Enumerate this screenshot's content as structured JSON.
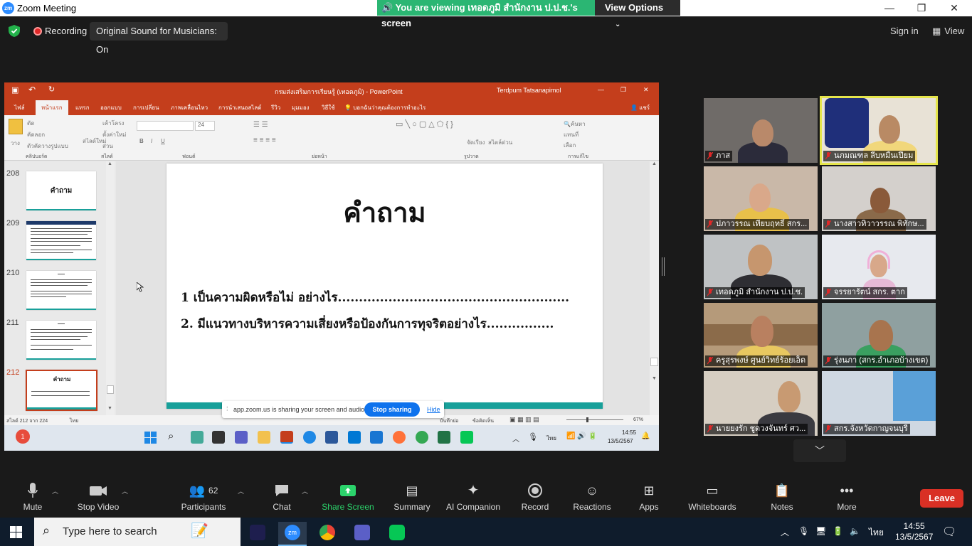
{
  "window": {
    "title": "Zoom Meeting",
    "logo": "zm",
    "minimize": "—",
    "restore": "❐",
    "close": "✕"
  },
  "banner": {
    "viewing": "You are viewing เทอดภูมิ สำนักงาน ป.ป.ช.'s screen",
    "view_options": "View Options"
  },
  "topbar": {
    "recording": "Recording",
    "original_sound": "Original Sound for Musicians: On",
    "sign_in": "Sign in",
    "view": "View"
  },
  "ppt": {
    "doc_title": "กรมส่งเสริมการเรียนรู้ (เทอดภูมิ) - PowerPoint",
    "user": "Terdpum Tatsanapimol",
    "tabs": [
      "ไฟล์",
      "หน้าแรก",
      "แทรก",
      "ออกแบบ",
      "การเปลี่ยน",
      "ภาพเคลื่อนไหว",
      "การนำเสนอสไลด์",
      "รีวิว",
      "มุมมอง",
      "วิธีใช้"
    ],
    "tell_me": "บอกฉันว่าคุณต้องการทำอะไร",
    "share": "แชร์",
    "ribbon": {
      "paste": "วาง",
      "cut": "ตัด",
      "copy": "คัดลอก",
      "format_painter": "ตัวคัดวางรูปแบบ",
      "new_slide": "สไลด์ใหม่",
      "layout": "เค้าโครง",
      "reset": "ตั้งค่าใหม่",
      "section": "ส่วน",
      "font_size": "24",
      "arrange": "จัดเรียง",
      "quick_styles": "สไตล์ด่วน",
      "find": "ค้นหา",
      "replace": "แทนที่",
      "select": "เลือก",
      "groups": [
        "คลิปบอร์ด",
        "สไลด์",
        "ฟอนต์",
        "ย่อหน้า",
        "รูปวาด",
        "การแก้ไข"
      ]
    },
    "thumbs": [
      {
        "num": "208",
        "title": "คำถาม"
      },
      {
        "num": "209",
        "title": ""
      },
      {
        "num": "210",
        "title": ""
      },
      {
        "num": "211",
        "title": ""
      },
      {
        "num": "212",
        "title": "คำถาม"
      }
    ],
    "slide": {
      "title": "คำถาม",
      "line1": "1 เป็นความผิดหรือไม่ อย่างไร.......................................................",
      "line2": "2. มีแนวทางบริหารความเสี่ยงหรือป้องกันการทุจริตอย่างไร................"
    },
    "status": {
      "slide_count": "สไลด์ 212 จาก 224",
      "language": "ไทย",
      "notes": "บันทึกย่อ",
      "comments": "ข้อคิดเห็น",
      "zoom": "67%"
    },
    "taskbar": {
      "time": "14:55",
      "date": "13/5/2567",
      "lang": "ไทย"
    }
  },
  "sharing_bar": {
    "text": "app.zoom.us is sharing your screen and audio.",
    "stop": "Stop sharing",
    "hide": "Hide"
  },
  "participants": [
    {
      "name": "ภาส"
    },
    {
      "name": "นภมณฑล ลีบหมื่นเปียม"
    },
    {
      "name": "ปภาวรรณ เทียบฤทธิ์ สกร..."
    },
    {
      "name": "นางสาวทิวาวรรณ พิทักษ..."
    },
    {
      "name": "เทอดภูมิ สำนักงาน ป.ป.ช."
    },
    {
      "name": "จรรยารัตน์ สกร. ตาก"
    },
    {
      "name": "ครูสุรพงษ์ ศูนย์วิทย์ร้อยเอ็ด"
    },
    {
      "name": "รุ่งนภา (สกร.อำเภอบ้างเขต)"
    },
    {
      "name": "นายยงรัก ชูดวงจันทร์ ศว..."
    },
    {
      "name": "สกร.จังหวัดกาญจนบุรี"
    }
  ],
  "toolbar": {
    "mute": "Mute",
    "stop_video": "Stop Video",
    "participants": "Participants",
    "participants_count": "62",
    "chat": "Chat",
    "share_screen": "Share Screen",
    "summary": "Summary",
    "ai_companion": "AI Companion",
    "record": "Record",
    "reactions": "Reactions",
    "apps": "Apps",
    "whiteboards": "Whiteboards",
    "notes": "Notes",
    "more": "More",
    "leave": "Leave"
  },
  "os_taskbar": {
    "search_placeholder": "Type here to search",
    "time": "14:55",
    "date": "13/5/2567",
    "lang": "ไทย",
    "notif_count": "1"
  },
  "colors": {
    "zoom_green": "#2bb673",
    "ppt_red": "#c43e1c",
    "teal": "#18a09a",
    "leave_red": "#d93025",
    "zoom_blue": "#0e72ed"
  }
}
